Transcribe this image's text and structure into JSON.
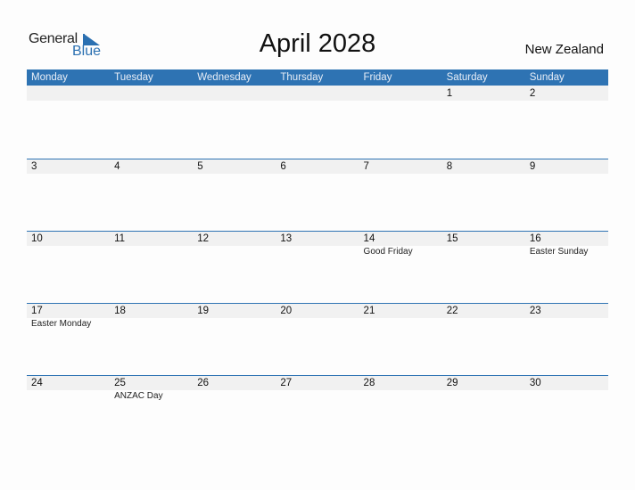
{
  "logo": {
    "general": "General",
    "blue": "Blue"
  },
  "title": "April 2028",
  "country": "New Zealand",
  "colors": {
    "accent": "#2e73b3",
    "date_strip": "#f1f1f1"
  },
  "weekdays": [
    "Monday",
    "Tuesday",
    "Wednesday",
    "Thursday",
    "Friday",
    "Saturday",
    "Sunday"
  ],
  "weeks": [
    [
      {
        "d": ""
      },
      {
        "d": ""
      },
      {
        "d": ""
      },
      {
        "d": ""
      },
      {
        "d": ""
      },
      {
        "d": "1"
      },
      {
        "d": "2"
      }
    ],
    [
      {
        "d": "3"
      },
      {
        "d": "4"
      },
      {
        "d": "5"
      },
      {
        "d": "6"
      },
      {
        "d": "7"
      },
      {
        "d": "8"
      },
      {
        "d": "9"
      }
    ],
    [
      {
        "d": "10"
      },
      {
        "d": "11"
      },
      {
        "d": "12"
      },
      {
        "d": "13"
      },
      {
        "d": "14",
        "h": "Good Friday"
      },
      {
        "d": "15"
      },
      {
        "d": "16",
        "h": "Easter Sunday"
      }
    ],
    [
      {
        "d": "17",
        "h": "Easter Monday"
      },
      {
        "d": "18"
      },
      {
        "d": "19"
      },
      {
        "d": "20"
      },
      {
        "d": "21"
      },
      {
        "d": "22"
      },
      {
        "d": "23"
      }
    ],
    [
      {
        "d": "24"
      },
      {
        "d": "25",
        "h": "ANZAC Day"
      },
      {
        "d": "26"
      },
      {
        "d": "27"
      },
      {
        "d": "28"
      },
      {
        "d": "29"
      },
      {
        "d": "30"
      }
    ]
  ]
}
